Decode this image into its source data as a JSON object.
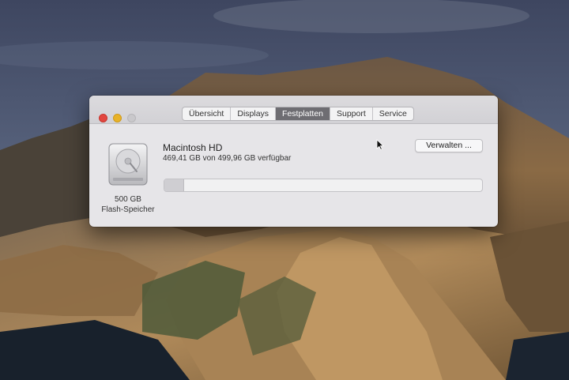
{
  "window": {
    "tabs": [
      {
        "label": "Übersicht",
        "active": false
      },
      {
        "label": "Displays",
        "active": false
      },
      {
        "label": "Festplatten",
        "active": true
      },
      {
        "label": "Support",
        "active": false
      },
      {
        "label": "Service",
        "active": false
      }
    ]
  },
  "storage": {
    "disk_icon": "hard-drive-icon",
    "capacity_size": "500 GB",
    "capacity_type": "Flash-Speicher",
    "volume_name": "Macintosh HD",
    "volume_usage": "469,41 GB von 499,96 GB verfügbar",
    "manage_label": "Verwalten ...",
    "used_fraction": 0.061
  },
  "colors": {
    "close": "#e2463f",
    "minimize": "#e8b228",
    "zoom": "#c9c8cb",
    "active_tab": "#6e6d72"
  }
}
